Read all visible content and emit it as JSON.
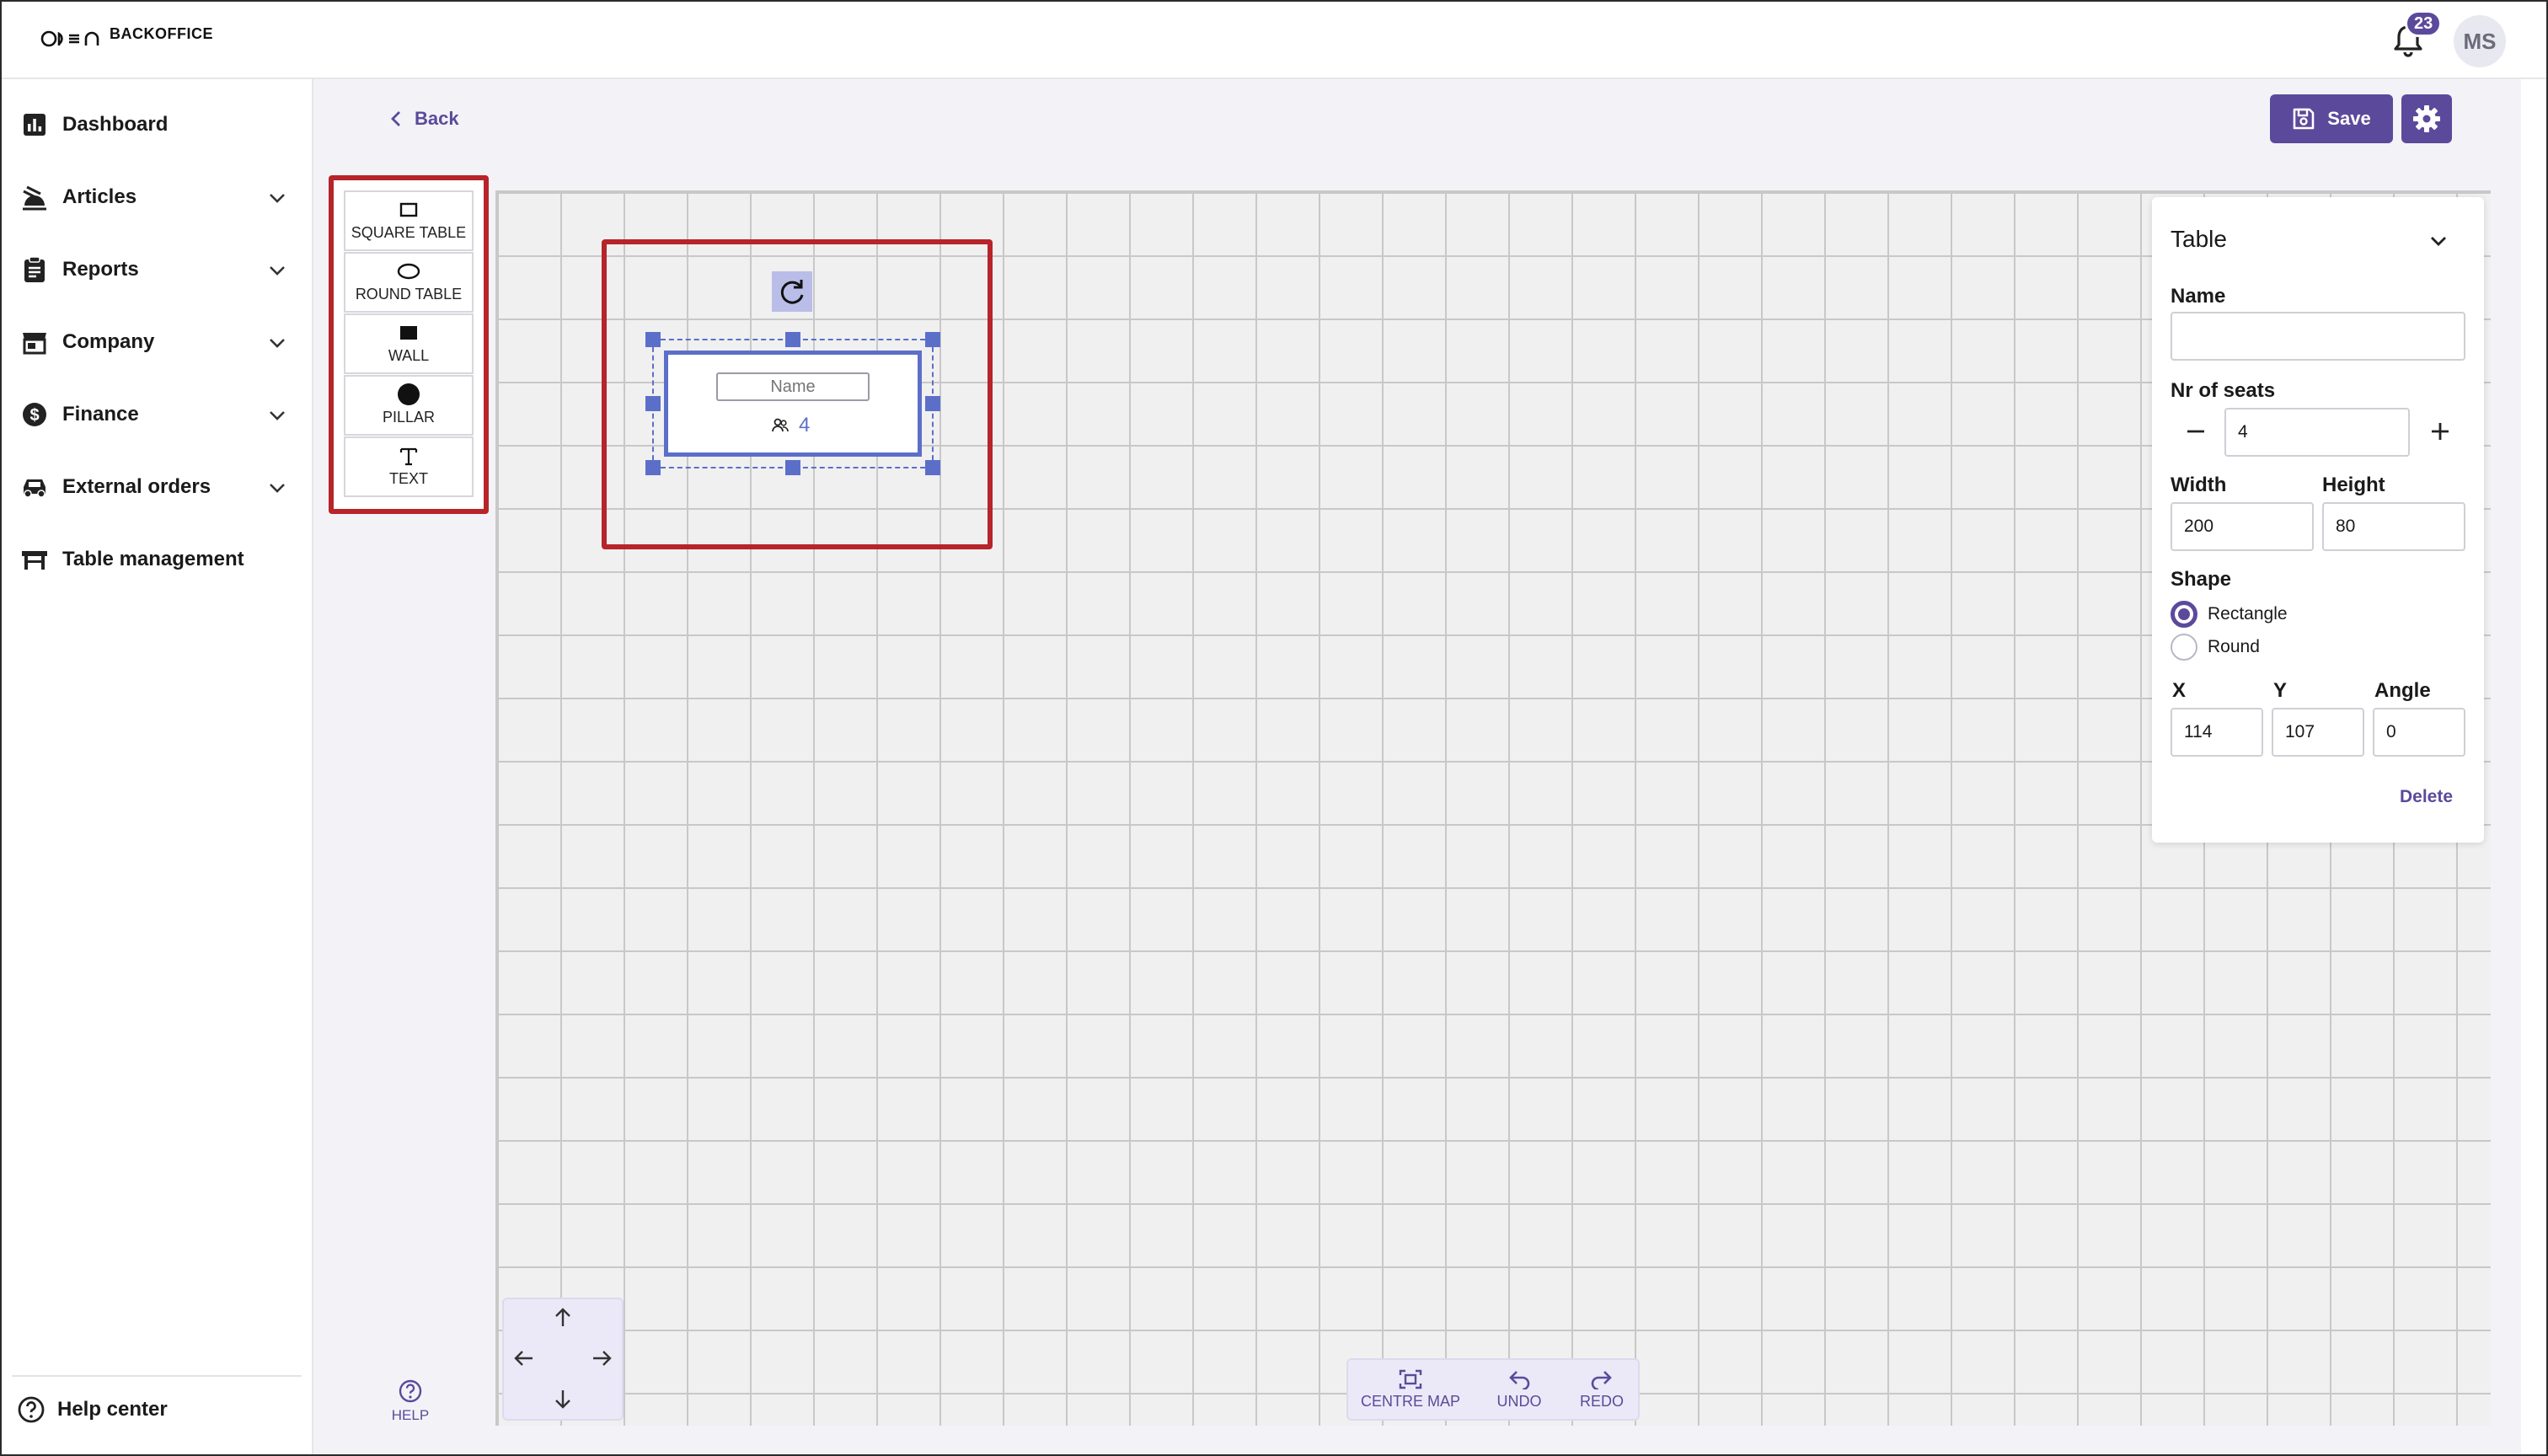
{
  "app": {
    "logo_text": "BACKOFFICE",
    "notification_count": "23",
    "avatar_initials": "MS"
  },
  "sidebar": {
    "items": [
      {
        "label": "Dashboard"
      },
      {
        "label": "Articles"
      },
      {
        "label": "Reports"
      },
      {
        "label": "Company"
      },
      {
        "label": "Finance"
      },
      {
        "label": "External orders"
      },
      {
        "label": "Table management"
      }
    ],
    "help_center": "Help center"
  },
  "header": {
    "back_label": "Back",
    "save_label": "Save"
  },
  "toolbox": {
    "tools": [
      {
        "label": "SQUARE TABLE"
      },
      {
        "label": "ROUND TABLE"
      },
      {
        "label": "WALL"
      },
      {
        "label": "PILLAR"
      },
      {
        "label": "TEXT"
      }
    ],
    "help_label": "HELP"
  },
  "canvas": {
    "table": {
      "name_placeholder": "Name",
      "seats": "4"
    }
  },
  "bottom_toolbar": {
    "centre_map": "CENTRE MAP",
    "undo": "UNDO",
    "redo": "REDO"
  },
  "properties": {
    "title": "Table",
    "name_label": "Name",
    "name_value": "",
    "seats_label": "Nr of seats",
    "seats_value": "4",
    "width_label": "Width",
    "width_value": "200",
    "height_label": "Height",
    "height_value": "80",
    "shape_label": "Shape",
    "shape_options": [
      {
        "label": "Rectangle",
        "checked": true
      },
      {
        "label": "Round",
        "checked": false
      }
    ],
    "x_label": "X",
    "x_value": "114",
    "y_label": "Y",
    "y_value": "107",
    "angle_label": "Angle",
    "angle_value": "0",
    "delete_label": "Delete"
  },
  "colors": {
    "accent": "#5b4a9b",
    "selection": "#5b6fc9",
    "highlight": "#b7242a"
  }
}
